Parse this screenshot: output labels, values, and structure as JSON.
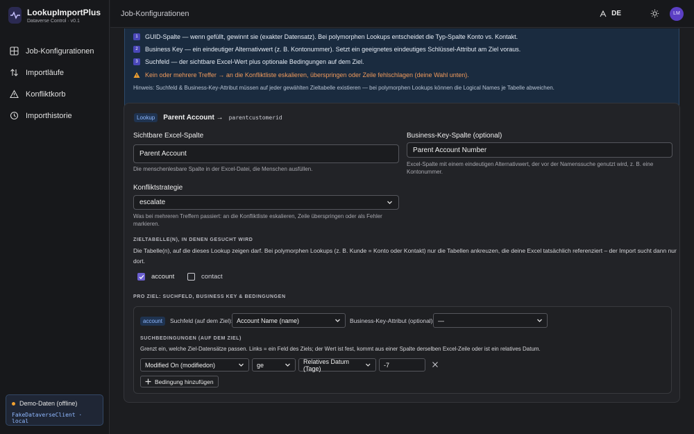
{
  "app": {
    "title": "LookupImportPlus",
    "subtitle": "Dataverse Control · v0.1"
  },
  "sidebar": {
    "items": [
      {
        "label": "Job-Konfigurationen",
        "icon": "grid-icon"
      },
      {
        "label": "Importläufe",
        "icon": "arrows-updown-icon"
      },
      {
        "label": "Konfliktkorb",
        "icon": "warning-triangle-icon"
      },
      {
        "label": "Importhistorie",
        "icon": "history-icon"
      }
    ],
    "demo": {
      "title": "Demo-Daten (offline)",
      "client": "FakeDataverseClient · local"
    }
  },
  "header": {
    "breadcrumb": "Job-Konfigurationen",
    "lang": "DE",
    "avatar": "LM"
  },
  "info": {
    "lines": [
      {
        "num": "1",
        "text": "GUID-Spalte — wenn gefüllt, gewinnt sie (exakter Datensatz). Bei polymorphen Lookups entscheidet die Typ-Spalte Konto vs. Kontakt."
      },
      {
        "num": "2",
        "text": "Business Key — ein eindeutiger Alternativwert (z. B. Kontonummer). Setzt ein geeignetes eindeutiges Schlüssel-Attribut am Ziel voraus."
      },
      {
        "num": "3",
        "text": "Suchfeld — der sichtbare Excel-Wert plus optionale Bedingungen auf dem Ziel."
      }
    ],
    "warning": "Kein oder mehrere Treffer → an die Konfliktliste eskalieren, überspringen oder Zeile fehlschlagen (deine Wahl unten).",
    "hint": "Hinweis: Suchfeld & Business-Key-Attribut müssen auf jeder gewählten Zieltabelle existieren — bei polymorphen Lookups können die Logical Names je Tabelle abweichen."
  },
  "lookup": {
    "badge": "Lookup",
    "title": "Parent Account →",
    "logical_name": "parentcustomerid",
    "excel_col": {
      "label": "Sichtbare Excel-Spalte",
      "value": "Parent Account",
      "help": "Die menschenlesbare Spalte in der Excel-Datei, die Menschen ausfüllen."
    },
    "bk_col": {
      "label": "Business-Key-Spalte (optional)",
      "value": "Parent Account Number",
      "help1": "Excel-Spalte mit einem eindeutigen Alternativwert, der vor der Namenssuche genutzt wird, z. B. eine",
      "help2": "Kontonummer."
    },
    "conflict": {
      "label": "Konfliktstrategie",
      "value": "escalate",
      "help1": "Was bei mehreren Treffern passiert: an die Konfliktliste eskalieren, Zeile überspringen oder als Fehler",
      "help2": "markieren."
    },
    "targets": {
      "section": "ZIELTABELLE(N), IN DENEN GESUCHT WIRD",
      "desc1": "Die Tabelle(n), auf die dieses Lookup zeigen darf. Bei polymorphen Lookups (z. B. Kunde = Konto oder Kontakt) nur die Tabellen ankreuzen, die deine Excel tatsächlich referenziert – der Import sucht dann nur",
      "desc2": "dort.",
      "options": [
        {
          "label": "account",
          "checked": true
        },
        {
          "label": "contact",
          "checked": false
        }
      ]
    },
    "per_target": {
      "section": "PRO ZIEL: SUCHFELD, BUSINESS KEY & BEDINGUNGEN",
      "badge": "account",
      "search_label": "Suchfeld (auf dem Ziel):",
      "search_value": "Account Name (name)",
      "bk_label": "Business-Key-Attribut (optional):",
      "bk_value": "—",
      "cond_section": "SUCHBEDINGUNGEN (AUF DEM ZIEL)",
      "cond_desc": "Grenzt ein, welche Ziel-Datensätze passen. Links = ein Feld des Ziels; der Wert ist fest, kommt aus einer Spalte derselben Excel-Zeile oder ist ein relatives Datum.",
      "condition": {
        "field": "Modified On (modifiedon)",
        "operator": "ge",
        "value_type": "Relatives Datum (Tage)",
        "value": "-7"
      },
      "add_label": "Bedingung hinzufügen"
    }
  }
}
